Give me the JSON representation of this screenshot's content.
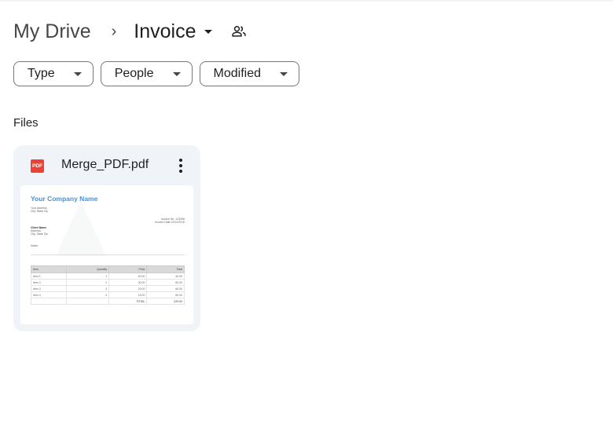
{
  "breadcrumb": {
    "root": "My Drive",
    "separator": "›",
    "current": "Invoice"
  },
  "filters": [
    {
      "label": "Type"
    },
    {
      "label": "People"
    },
    {
      "label": "Modified"
    }
  ],
  "section_title": "Files",
  "file": {
    "name": "Merge_PDF.pdf",
    "icon_label": "PDF",
    "icon_color": "#ea4335",
    "thumbnail": {
      "company": "Your Company Name",
      "address": "Your Address",
      "city": "City, State Zip",
      "invoice_no": "Invoice No. 123456",
      "invoice_date": "Invoice Date 01/01/2016",
      "client_name": "Client Name",
      "client_address": "Address",
      "client_city": "City, State Zip",
      "notes": "Notes",
      "headers": [
        "Item",
        "Quantity",
        "Price",
        "Total"
      ],
      "rows": [
        [
          "Item 1",
          "1",
          "40.00",
          "40.00"
        ],
        [
          "Item 2",
          "2",
          "30.00",
          "60.00"
        ],
        [
          "Item 3",
          "3",
          "20.00",
          "60.00"
        ],
        [
          "Item 4",
          "4",
          "15.00",
          "60.00"
        ]
      ],
      "total_label": "TOTAL",
      "total_value": "220.00"
    }
  }
}
